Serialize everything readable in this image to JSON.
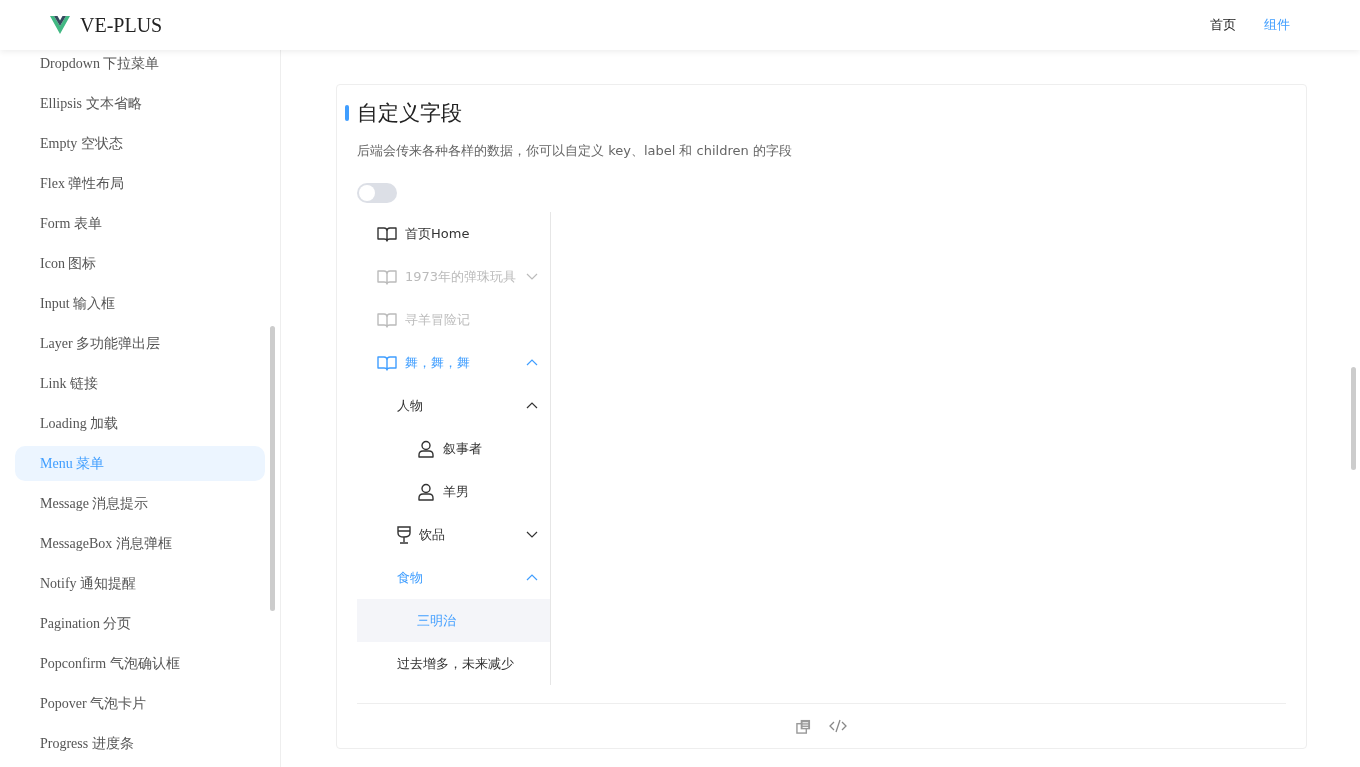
{
  "header": {
    "logo_text": "VE-PLUS",
    "nav": [
      {
        "label": "首页",
        "selected": false
      },
      {
        "label": "组件",
        "selected": true
      }
    ]
  },
  "sidebar": {
    "items": [
      {
        "label": "Dropdown 下拉菜单",
        "selected": false
      },
      {
        "label": "Ellipsis 文本省略",
        "selected": false
      },
      {
        "label": "Empty 空状态",
        "selected": false
      },
      {
        "label": "Flex 弹性布局",
        "selected": false
      },
      {
        "label": "Form 表单",
        "selected": false
      },
      {
        "label": "Icon 图标",
        "selected": false
      },
      {
        "label": "Input 输入框",
        "selected": false
      },
      {
        "label": "Layer 多功能弹出层",
        "selected": false
      },
      {
        "label": "Link 链接",
        "selected": false
      },
      {
        "label": "Loading 加载",
        "selected": false
      },
      {
        "label": "Menu 菜单",
        "selected": true
      },
      {
        "label": "Message 消息提示",
        "selected": false
      },
      {
        "label": "MessageBox 消息弹框",
        "selected": false
      },
      {
        "label": "Notify 通知提醒",
        "selected": false
      },
      {
        "label": "Pagination 分页",
        "selected": false
      },
      {
        "label": "Popconfirm 气泡确认框",
        "selected": false
      },
      {
        "label": "Popover 气泡卡片",
        "selected": false
      },
      {
        "label": "Progress 进度条",
        "selected": false
      }
    ]
  },
  "demo": {
    "title": "自定义字段",
    "description": "后端会传来各种各样的数据，你可以自定义 key、label 和 children 的字段",
    "toggle": {
      "on": false
    },
    "menu": {
      "items": [
        {
          "kind": "book_item",
          "label": "首页Home",
          "disabled": false,
          "selected": false
        },
        {
          "kind": "book_submenu",
          "label": "1973年的弹珠玩具",
          "disabled": true,
          "active": false,
          "expanded": false
        },
        {
          "kind": "book_item",
          "label": "寻羊冒险记",
          "disabled": true,
          "selected": false
        },
        {
          "kind": "book_submenu",
          "label": "舞，舞，舞",
          "disabled": false,
          "active": true,
          "expanded": true,
          "children": [
            {
              "kind": "submenu",
              "label": "人物",
              "disabled": false,
              "active": false,
              "expanded": true,
              "children": [
                {
                  "kind": "person_item",
                  "label": "叙事者",
                  "disabled": false,
                  "selected": false
                },
                {
                  "kind": "person_item",
                  "label": "羊男",
                  "disabled": false,
                  "selected": false
                }
              ]
            },
            {
              "kind": "goblet_submenu",
              "label": "饮品",
              "disabled": false,
              "active": false,
              "expanded": false
            },
            {
              "kind": "submenu",
              "label": "食物",
              "disabled": false,
              "active": true,
              "expanded": true,
              "children": [
                {
                  "kind": "item",
                  "label": "三明治",
                  "disabled": false,
                  "selected": true
                }
              ]
            },
            {
              "kind": "item",
              "label": "过去增多，未来减少",
              "disabled": false,
              "selected": false
            }
          ]
        }
      ]
    }
  }
}
